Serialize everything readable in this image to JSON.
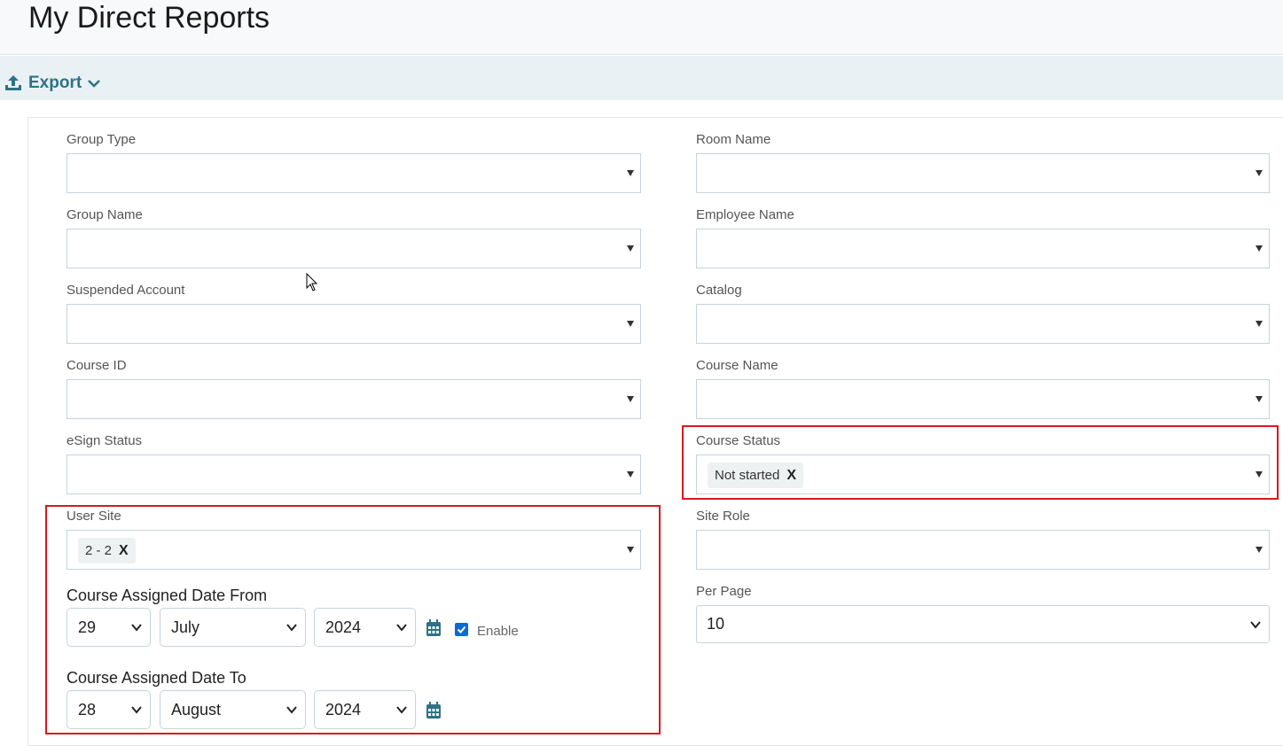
{
  "page": {
    "title": "My Direct Reports"
  },
  "toolbar": {
    "export_label": "Export"
  },
  "filters": {
    "group_type": {
      "label": "Group Type"
    },
    "group_name": {
      "label": "Group Name"
    },
    "suspended_account": {
      "label": "Suspended Account"
    },
    "course_id": {
      "label": "Course ID"
    },
    "esign_status": {
      "label": "eSign Status"
    },
    "user_site": {
      "label": "User Site",
      "selected": [
        "2 - 2"
      ]
    },
    "room_name": {
      "label": "Room Name"
    },
    "employee_name": {
      "label": "Employee Name"
    },
    "catalog": {
      "label": "Catalog"
    },
    "course_name": {
      "label": "Course Name"
    },
    "course_status": {
      "label": "Course Status",
      "selected": [
        "Not started"
      ]
    },
    "site_role": {
      "label": "Site Role"
    },
    "per_page": {
      "label": "Per Page",
      "value": "10"
    }
  },
  "chip_remove": "X",
  "date_from": {
    "label": "Course Assigned Date From",
    "day": "29",
    "month": "July",
    "year": "2024",
    "enable_label": "Enable",
    "enabled": true
  },
  "date_to": {
    "label": "Course Assigned Date To",
    "day": "28",
    "month": "August",
    "year": "2024"
  },
  "colors": {
    "accent": "#2e7285",
    "highlight": "#d9191c",
    "checkbox": "#0a6ad8"
  }
}
